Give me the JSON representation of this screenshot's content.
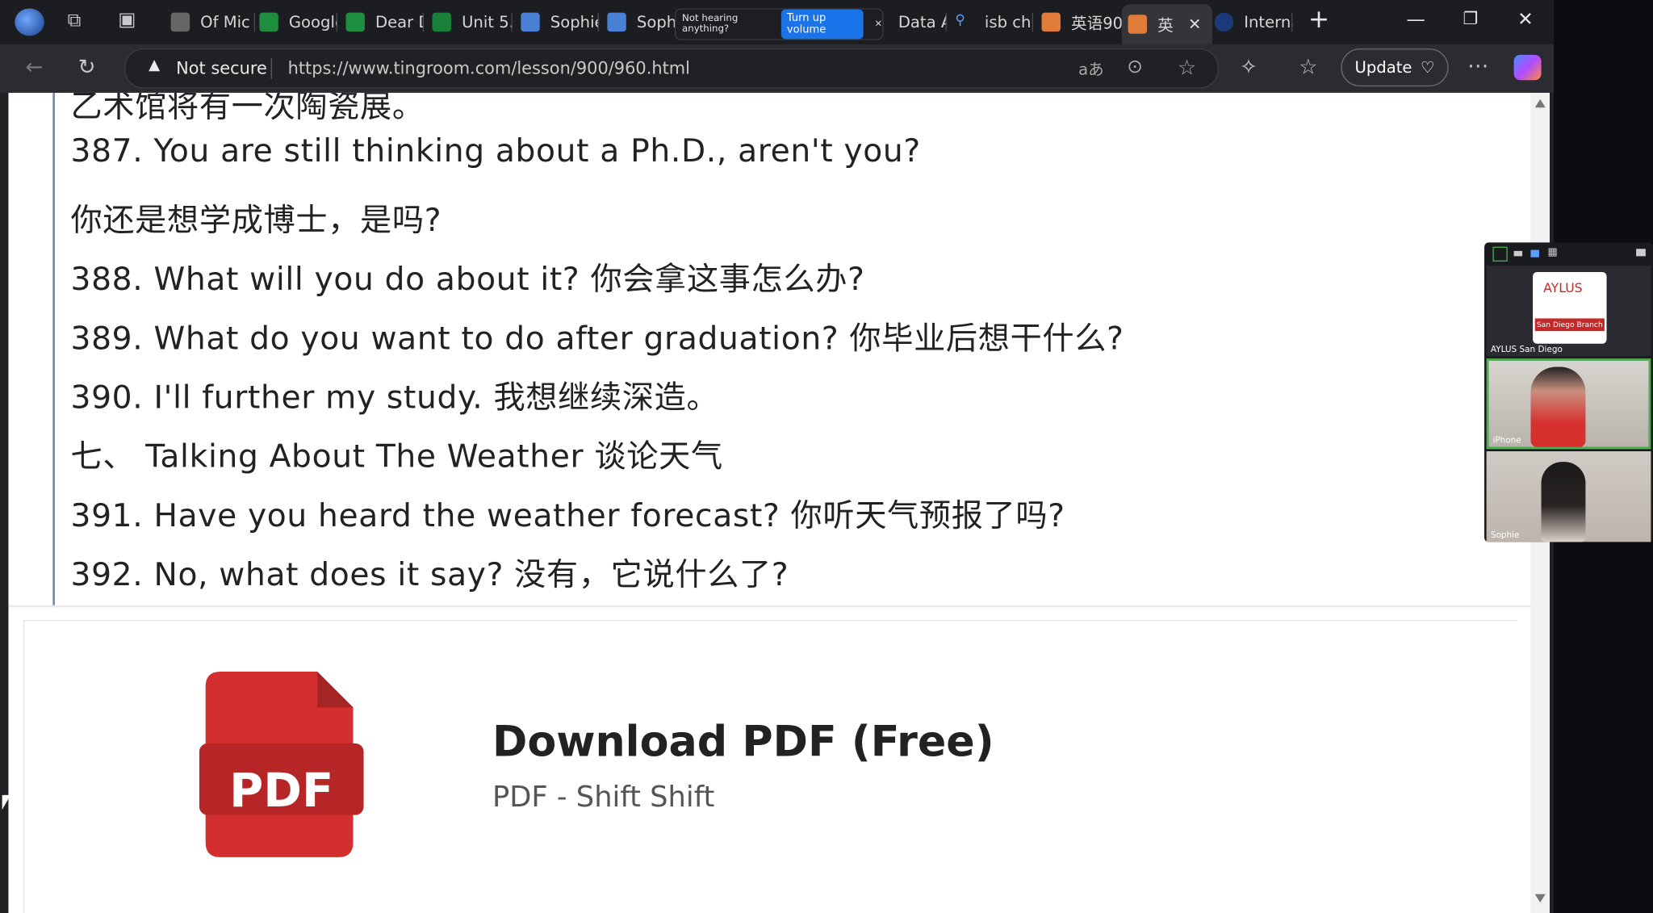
{
  "tabs": [
    {
      "label": "Of Mic",
      "icon": "app-icon"
    },
    {
      "label": "Google",
      "icon": "sheets-icon"
    },
    {
      "label": "Dear D",
      "icon": "sheets-icon"
    },
    {
      "label": "Unit 5.",
      "icon": "classroom-icon"
    },
    {
      "label": "Sophie",
      "icon": "docs-icon"
    },
    {
      "label": "Sophi",
      "icon": "docs-icon"
    },
    {
      "label": "Data A",
      "icon": "page-icon"
    },
    {
      "label": "isb chi",
      "icon": "search-icon"
    },
    {
      "label": "英语90",
      "icon": "site-icon"
    },
    {
      "label": "英",
      "icon": "site-icon",
      "active": true
    },
    {
      "label": "Interna",
      "icon": "globe-icon"
    }
  ],
  "toast": {
    "text": "Not hearing anything?",
    "button": "Turn up volume"
  },
  "address": {
    "security": "Not secure",
    "url": "https://www.tingroom.com/lesson/900/960.html"
  },
  "toolbar": {
    "update_label": "Update"
  },
  "content": {
    "partial_top": "乙术馆将有一次陶瓷展。",
    "lines": [
      "387. You are still thinking about a Ph.D., aren't you?",
      "你还是想学成博士，是吗?",
      "388. What will you do about it? 你会拿这事怎么办?",
      "389. What do you want to do after graduation? 你毕业后想干什么?",
      "390. I'll further my study. 我想继续深造。",
      "七、 Talking About The Weather 谈论天气",
      "391. Have you heard the weather forecast? 你听天气预报了吗?",
      "392. No, what does it say? 没有，它说什么了?"
    ]
  },
  "pdf": {
    "badge": "PDF",
    "title": "Download PDF (Free)",
    "subtitle": "PDF - Shift Shift"
  },
  "video": {
    "participants": [
      {
        "name": "AYLUS San Diego",
        "logo_text": "AYLUS",
        "logo_sub": "San Diego Branch"
      },
      {
        "name": "iPhone"
      },
      {
        "name": "Sophie"
      }
    ]
  },
  "colors": {
    "accent": "#1a73e8",
    "pdf_red": "#d32f2f",
    "aylus_red": "#c62828"
  }
}
